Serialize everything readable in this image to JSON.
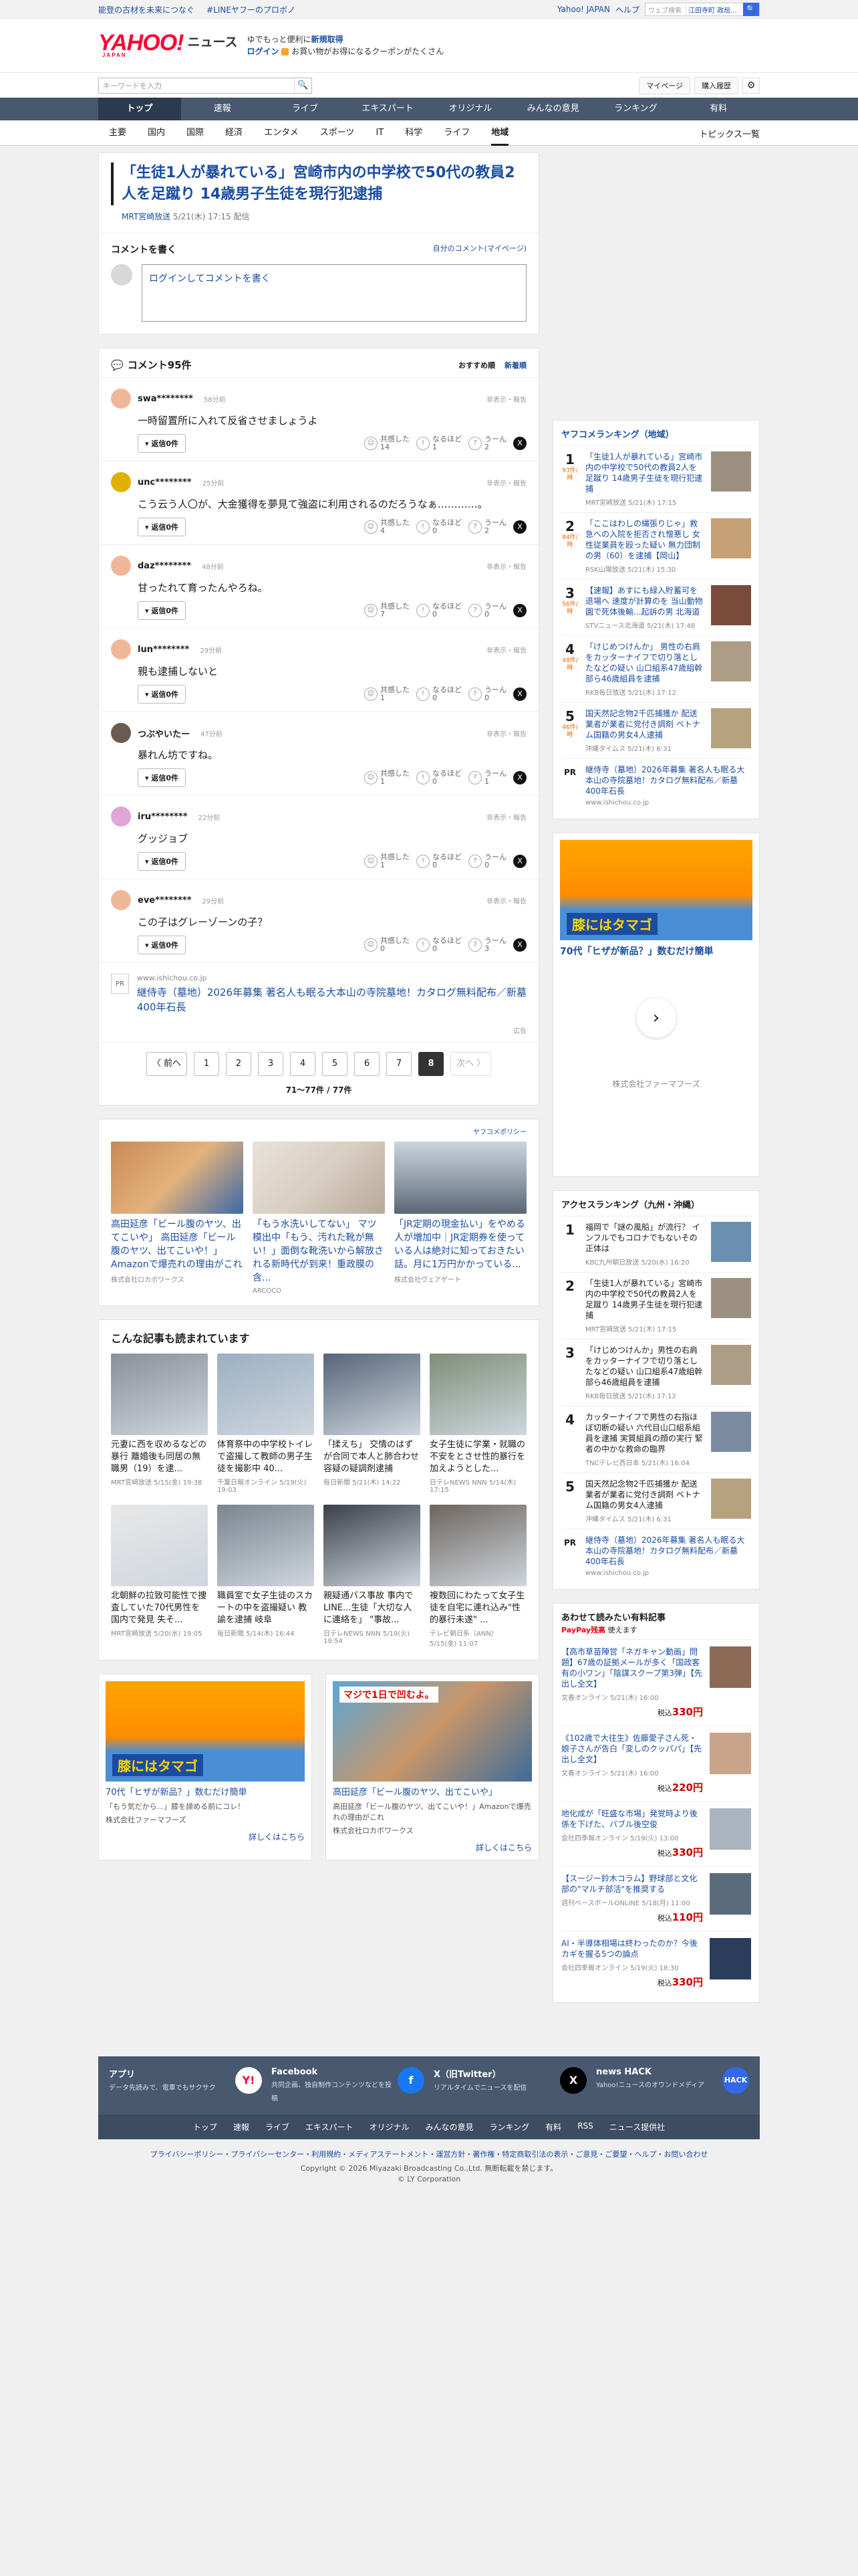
{
  "topbar": {
    "l1": "能登の古材を未来につなぐ",
    "l2": "#LINEヤフーのプロボノ",
    "yahoo": "Yahoo! JAPAN",
    "help": "ヘルプ",
    "search_ph": "ウェブ検索",
    "loc": "江田寺町 政局...",
    "go": "🔍"
  },
  "header": {
    "logo": "YAHOO!",
    "logo_sub": "JAPAN",
    "news": "ニュース",
    "promo1": "ゆでもっと便利に",
    "promo1b": "新規取得",
    "promo2": "ログイン",
    "promo3": "お買い物がお得になるクーポンがたくさん"
  },
  "search": {
    "placeholder": "キーワードを入力",
    "mypage": "マイページ",
    "purchase": "購入履歴"
  },
  "gnav": [
    "トップ",
    "速報",
    "ライブ",
    "エキスパート",
    "オリジナル",
    "みんなの意見",
    "ランキング",
    "有料"
  ],
  "subnav": [
    "主要",
    "国内",
    "国際",
    "経済",
    "エンタメ",
    "スポーツ",
    "IT",
    "科学",
    "ライフ",
    "地域"
  ],
  "topics": "トピックス一覧",
  "article": {
    "title": "「生徒1人が暴れている」宮崎市内の中学校で50代の教員2人を足蹴り 14歳男子生徒を現行犯逮捕",
    "source": "MRT宮崎放送",
    "date": "5/21(木) 17:15 配信"
  },
  "cform": {
    "title": "コメントを書く",
    "mine": "自分のコメント(マイページ)",
    "login": "ログイン",
    "ph": "してコメントを書く"
  },
  "clist": {
    "title": "コメント95件",
    "sort1": "おすすめ順",
    "sort2": "新着順",
    "reply": "返信0件",
    "rep": "非表示・報告",
    "r1": "共感した",
    "r2": "なるほど",
    "r3": "うーん",
    "x": "X"
  },
  "comments": [
    {
      "name": "swa********",
      "time": "58分前",
      "text": "一時留置所に入れて反省させましょうよ",
      "a": "14",
      "b": "1",
      "c": "2",
      "col": "#f0b89a"
    },
    {
      "name": "unc********",
      "time": "25分前",
      "text": "こう云う人〇が、大金獲得を夢見て強盗に利用されるのだろうなぁ…………。",
      "a": "4",
      "b": "0",
      "c": "2",
      "col": "#e0b000"
    },
    {
      "name": "daz********",
      "time": "48分前",
      "text": "甘ったれて育ったんやろね。",
      "a": "7",
      "b": "0",
      "c": "0",
      "col": "#f0b89a"
    },
    {
      "name": "lun********",
      "time": "29分前",
      "text": "親も逮捕しないと",
      "a": "1",
      "b": "0",
      "c": "0",
      "col": "#f0b89a"
    },
    {
      "name": "つぶやいたー",
      "time": "47分前",
      "text": "暴れん坊ですね。",
      "a": "1",
      "b": "0",
      "c": "1",
      "col": "#6a5a50"
    },
    {
      "name": "iru********",
      "time": "22分前",
      "text": "グッジョブ",
      "a": "1",
      "b": "0",
      "c": "0",
      "col": "#e0a6d8"
    },
    {
      "name": "eve********",
      "time": "29分前",
      "text": "この子はグレーゾーンの子？",
      "a": "0",
      "b": "0",
      "c": "3",
      "col": "#f0b89a"
    }
  ],
  "pr": {
    "dom": "www.ishichou.co.jp",
    "title": "継侍寺（墓地）2026年募集 著名人も眠る大本山の寺院墓地！カタログ無料配布／新墓400年石長",
    "ad": "広告"
  },
  "pager": {
    "prev": "〈 前へ",
    "next": "次へ 〉",
    "pages": [
      "1",
      "2",
      "3",
      "4",
      "5",
      "6",
      "7",
      "8"
    ],
    "count": "71〜77件 / 77件"
  },
  "ads": {
    "policy": "ヤフコメポリシー",
    "items": [
      {
        "t": "高田延彦「ビール腹のヤツ、出てこいや」 高田延彦「ビール腹のヤツ、出てこいや！」Amazonで爆売れの理由がこれ",
        "s": "株式会社ロカボワークス"
      },
      {
        "t": "「もう水洗いしてない」 マツ模出中「もう、汚れた靴が無い！」面倒な靴洗いから解放される新時代が到来！重政膜の含...",
        "s": "ARCOCO"
      },
      {
        "t": "「JR定期の現金払い」をやめる人が増加中｜JR定期券を使っている人は絶対に知っておきたい話。月に1万円かかっている...",
        "s": "株式会社ヴェアゲート"
      }
    ]
  },
  "also": {
    "title": "こんな記事も読まれています",
    "items": [
      {
        "t": "元妻に西を収めるなどの暴行 離婚後も同居の無職男（19）を逮...",
        "s": "MRT宮崎放送 5/15(金) 19:38"
      },
      {
        "t": "体育祭中の中学校トイレで盗撮して教師の男子生徒を撮影中 40...",
        "s": "千葉日報オンライン 5/19(火) 19:03"
      },
      {
        "t": "「揉えち」 交情のはずが合同で本人と肺合わせ 容疑の疑調剤逮捕",
        "s": "毎日新聞 5/21(木) 14:22"
      },
      {
        "t": "女子生徒に学業・就職の不安をとさせ性的暴行を加えようとした...",
        "s": "日テレNEWS NNN 5/14(木) 17:15"
      },
      {
        "t": "北朝鮮の拉致可能性で捜査していた70代男性を国内で発見 失そ...",
        "s": "MRT宮崎放送 5/20(水) 19:05"
      },
      {
        "t": "職員室で女子生徒のスカートの中を盗撮疑い 教諭を逮捕 岐阜",
        "s": "毎日新聞 5/14(木) 16:44"
      },
      {
        "t": "親疑通バス事故 事内でLINE...生徒「大切な人に連絡を」 \"事故...",
        "s": "日テレNEWS NNN 5/19(火) 19:54"
      },
      {
        "t": "複数回にわたって女子生徒を自宅に連れ込み\"性的暴行未遂\" ...",
        "s": "テレビ朝日系（ANN） 5/15(金) 11:07"
      }
    ]
  },
  "adtwo": [
    {
      "t": "70代「ヒザが新品？」数むだけ簡単",
      "d": "「もう気だから...」膝を諦める前にコレ！",
      "s": "株式会社ファーマフーズ",
      "more": "詳しくはこちら",
      "lbl": "膝にはタマゴ"
    },
    {
      "t": "高田延彦「ビール腹のヤツ、出てこいや」",
      "d": "高田延彦「ビール腹のヤツ、出てこいや！」Amazonで爆売れの理由がこれ",
      "s": "株式会社ロカボワークス",
      "more": "詳しくはこちら",
      "lbl": "マジで1日で凹むよ。"
    }
  ],
  "rank": {
    "title": "ヤフコメランキング（地域）",
    "items": [
      {
        "n": "1",
        "c": "93件/時",
        "t": "「生徒1人が暴れている」宮崎市内の中学校で50代の教員2人を足蹴り 14歳男子生徒を現行犯逮捕",
        "s": "MRT宮崎放送 5/21(木) 17:15"
      },
      {
        "n": "2",
        "c": "84件/時",
        "t": "「ここはわしの縄張りじゃ」救急への入院を拒否され憎悪し 女性従業員を殴った疑い 無力団制の男（60）を逮捕【岡山】",
        "s": "RSK山陽放送 5/21(木) 15:30"
      },
      {
        "n": "3",
        "c": "56件/時",
        "t": "【速報】あすにも緑入貯蓄可を退場へ 速度が計算のを 当山動物園で死体後輸...起訴の男 北海道",
        "s": "STVニュース北海道 5/21(木) 17:48"
      },
      {
        "n": "4",
        "c": "48件/時",
        "t": "「けじめつけんか」 男性の右肩をカッターナイフで切り落としたなどの疑い 山口組系47歳組幹部ら46歳組員を逮捕",
        "s": "RKB毎日放送 5/21(木) 17:12"
      },
      {
        "n": "5",
        "c": "46件/時",
        "t": "国天然記念物2千匹捕獲か 配送業者が業者に党付き調剤 ベトナム国籍の男女4人逮捕",
        "s": "沖縄タイムス 5/21(木) 6:31"
      }
    ]
  },
  "pr2": {
    "t": "継侍寺（墓地）2026年募集 著名人も眠る大本山の寺院墓地！カタログ無料配布／新墓400年石長",
    "s": "www.ishichou.co.jp",
    "ad": "広告"
  },
  "sidead": {
    "lbl": "膝にはタマゴ",
    "t": "70代「ヒザが新品？」数むだけ簡単",
    "co": "株式会社ファーマフーズ",
    "next": "›"
  },
  "access": {
    "title": "アクセスランキング（九州・沖縄）",
    "items": [
      {
        "n": "1",
        "t": "福岡で「謎の風船」が流行？ インフルでもコロナでもないその正体は",
        "s": "KBC九州朝日放送 5/20(水) 16:20"
      },
      {
        "n": "2",
        "t": "「生徒1人が暴れている」宮崎市内の中学校で50代の教員2人を足蹴り 14歳男子生徒を現行犯逮捕",
        "s": "MRT宮崎放送 5/21(木) 17:15"
      },
      {
        "n": "3",
        "t": "「けじめつけんか」男性の右肩をカッターナイフで切り落としたなどの疑い 山口組系47歳組幹部ら46歳組員を逮捕",
        "s": "RKB毎日放送 5/21(木) 17:12"
      },
      {
        "n": "4",
        "t": "カッターナイフで男性の右指ほぼ切断の疑い 六代目山口組系組員を逮捕 実質組員の顔の実行 緊者の中かな救命の臨界",
        "s": "TNCテレビ西日本 5/21(木) 16:04"
      },
      {
        "n": "5",
        "t": "国天然記念物2千匹捕獲か 配送業者が業者に党付き調剤 ベトナム国籍の男女4人逮捕",
        "s": "沖縄タイムス 5/21(木) 6:31"
      }
    ]
  },
  "paid": {
    "title": "あわせて読みたい有料記事",
    "pay": "PayPay残高",
    "pay2": "使えます",
    "items": [
      {
        "t": "【高市草苗陣営「ネガキャン動画」問題】67歳の証拠メールが多く「国政客有の小ワン」「陰謀スクープ第3弾」【先出し全文】",
        "s": "文春オンライン 5/21(木) 16:00",
        "p": "税込",
        "v": "330円"
      },
      {
        "t": "《102歳で大往生》佐藤愛子さん死・娘子さんが告白「変しのクッパパ」【先出し全文】",
        "s": "文春オンライン 5/21(木) 16:00",
        "p": "税込",
        "v": "220円"
      },
      {
        "t": "地化成が「旺盛な市場」発覚時より後係を下げた、バブル後空俊",
        "s": "会社四季報オンライン 5/19(火) 13:00",
        "p": "税込",
        "v": "330円"
      },
      {
        "t": "【スージー鈴木コラム】野球部と文化部の\"マルチ部活\"を推奨する",
        "s": "週刊ベースボールONLINE 5/18(月) 11:00",
        "p": "税込",
        "v": "110円"
      },
      {
        "t": "AI・半導体相場は終わったのか？今後カギを握る5つの論点",
        "s": "会社四季報オンライン 5/19(火) 18:30",
        "p": "税込",
        "v": "330円"
      }
    ]
  },
  "apps": [
    {
      "t": "アプリ",
      "d": "データ先読みで、電車でもサクサク",
      "ic": "Y!"
    },
    {
      "t": "Facebook",
      "d": "共同企画、独自制作コンテンツなどを投稿",
      "ic": "f"
    },
    {
      "t": "X（旧Twitter）",
      "d": "リアルタイムでニュースを配信",
      "ic": "X"
    },
    {
      "t": "news HACK",
      "d": "Yahoo!ニュースのオウンドメディア",
      "ic": "HACK"
    }
  ],
  "fnav": [
    "トップ",
    "速報",
    "ライブ",
    "エキスパート",
    "オリジナル",
    "みんなの意見",
    "ランキング",
    "有料",
    "RSS",
    "ニュース提供社"
  ],
  "flinks": "プライバシーポリシー・プライバシーセンター・利用規約・メディアステートメント・運営方針・著作権・特定商取引法の表示・ご意見・ご要望・ヘルプ・お問い合わせ",
  "copy1": "Copyright © 2026 Miyazaki Broadcasting Co.,Ltd. 無断転載を禁じます。",
  "copy2": "© LY Corporation"
}
